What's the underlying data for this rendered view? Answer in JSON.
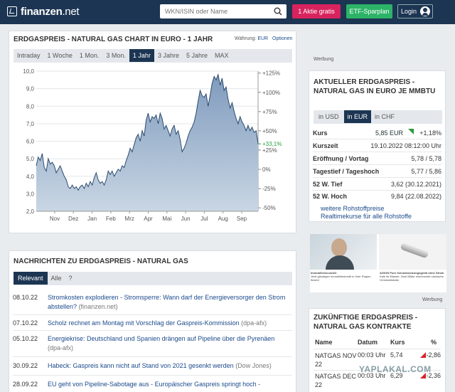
{
  "header": {
    "logo": "finanzen",
    "logo_suffix": ".net",
    "search_placeholder": "WKN/ISIN oder Name",
    "btn_aktie": "1 Aktie gratis",
    "btn_etf": "ETF-Sparplan",
    "btn_login": "Login"
  },
  "chart_panel": {
    "title": "ERDGASPREIS - NATURAL GAS CHART IN EURO - 1 JAHR",
    "waehrung_label": "Währung:",
    "waehrung_value": "EUR",
    "optionen": "Optionen",
    "tabs": [
      "Intraday",
      "1 Woche",
      "1 Mon.",
      "3 Mon.",
      "1 Jahr",
      "3 Jahre",
      "5 Jahre",
      "MAX"
    ],
    "active_tab": "1 Jahr"
  },
  "chart_data": {
    "type": "area",
    "x_ticks": [
      "Nov",
      "Dez",
      "Jan",
      "Feb",
      "Mrz",
      "Apr",
      "Mai",
      "Jun",
      "Jul",
      "Aug",
      "Sep"
    ],
    "y_ticks": [
      "2,0",
      "3,0",
      "4,0",
      "5,0",
      "6,0",
      "7,0",
      "8,0",
      "9,0",
      "10,0"
    ],
    "ylim": [
      2,
      10
    ],
    "y2_ticks": [
      "+125%",
      "+100%",
      "+75%",
      "+50%",
      "+25%",
      "0%",
      "-25%",
      "-50%"
    ],
    "y2_values": [
      125,
      100,
      75,
      50,
      25,
      0,
      -25,
      -50
    ],
    "current_label": "+33,1%",
    "current_value": 5.85,
    "series": [
      {
        "values": [
          4.6,
          5.1,
          4.9,
          5.3,
          4.5,
          4.3,
          5.0,
          4.7,
          4.8,
          4.6,
          4.2,
          4.4,
          4.6,
          4.3,
          4.0,
          3.8,
          3.4,
          3.3,
          3.5,
          3.3,
          3.4,
          3.2,
          3.4,
          3.5,
          3.3,
          3.6,
          3.4,
          3.7,
          3.5,
          3.9,
          4.2,
          3.8,
          3.6,
          3.7,
          3.5,
          3.8,
          4.3,
          4.1,
          4.3,
          4.0,
          4.2,
          4.4,
          4.3,
          4.6,
          4.5,
          4.9,
          5.2,
          5.6,
          5.4,
          5.8,
          6.2,
          6.4,
          6.0,
          6.6,
          6.3,
          7.2,
          7.6,
          7.1,
          7.4,
          7.3,
          7.5,
          7.0,
          7.6,
          7.3,
          6.7,
          6.9,
          6.6,
          6.3,
          6.7,
          6.9,
          6.4,
          6.6,
          6.1,
          5.4,
          5.6,
          5.9,
          6.3,
          6.6,
          6.8,
          7.1,
          7.6,
          8.3,
          8.9,
          8.6,
          8.5,
          8.7,
          8.0,
          8.6,
          9.3,
          9.7,
          9.5,
          9.8,
          9.2,
          9.6,
          8.9,
          9.1,
          8.4,
          7.9,
          8.2,
          7.7,
          7.3,
          7.0,
          7.4,
          7.1,
          6.9,
          6.6,
          6.9,
          6.6,
          6.8,
          6.5,
          6.6,
          5.85
        ]
      }
    ]
  },
  "news_panel": {
    "title": "NACHRICHTEN ZU ERDGASPREIS - NATURAL GAS",
    "tabs": [
      "Relevant",
      "Alle",
      "?"
    ],
    "items": [
      {
        "date": "08.10.22",
        "text": "Stromkosten explodieren - Stromsperre: Wann darf der Energieversorger den Strom abstellen?",
        "source": "(finanzen.net)"
      },
      {
        "date": "07.10.22",
        "text": "Scholz rechnet am Montag mit Vorschlag der Gaspreis-Kommission",
        "source": "(dpa-afx)"
      },
      {
        "date": "05.10.22",
        "text": "Energiekrise: Deutschland und Spanien drängen auf Pipeline über die Pyrenäen",
        "source": "(dpa-afx)"
      },
      {
        "date": "30.09.22",
        "text": "Habeck: Gaspreis kann nicht auf Stand von 2021 gesenkt werden",
        "source": "(Dow Jones)"
      },
      {
        "date": "28.09.22",
        "text": "EU geht von Pipeline-Sabotage aus - Europäischer Gaspreis springt hoch -",
        "source": ""
      }
    ]
  },
  "werbung_label": "Werbung",
  "current_panel": {
    "title": "AKTUELLER ERDGASPREIS - NATURAL GAS IN EURO JE MMBTU",
    "tabs": [
      "in USD",
      "in EUR",
      "in CHF"
    ],
    "active_tab": "in EUR",
    "rows": [
      {
        "key": "Kurs",
        "value": "5,85 EUR",
        "change": "+1,18%"
      },
      {
        "key": "Kurszeit",
        "value": "19.10.2022 08:12:00 Uhr"
      },
      {
        "key": "Eröffnung / Vortag",
        "value": "5,78 / 5,78"
      },
      {
        "key": "Tagestief / Tageshoch",
        "value": "5,77 / 5,86"
      },
      {
        "key": "52 W. Tief",
        "value": "3,62 (30.12.2021)"
      },
      {
        "key": "52 W. Hoch",
        "value": "9,84 (22.08.2022)"
      }
    ],
    "links": [
      "weitere Rohstoffpreise",
      "Realtimekurse für alle Rohstoffe"
    ]
  },
  "ads": [
    {
      "title": "Immobilienscout24",
      "text": "Jetzt günstigen Immobilienkredit in Ihrer Region finden!"
    },
    {
      "title": "AGION Pure Schutzbeutzungsgerät ohne Strom",
      "text": "Kalk im Wasser: Zwei Bilder erschrecken deutsche Grünkohlkäufer"
    }
  ],
  "future_panel": {
    "title": "ZUKÜNFTIGE ERDGASPREIS - NATURAL GAS KONTRAKTE",
    "headers": [
      "Name",
      "Datum",
      "Kurs",
      "%"
    ],
    "rows": [
      {
        "name": "NATGAS NOV 22",
        "date": "00:03 Uhr",
        "kurs": "5,74",
        "pct": "-2,86"
      },
      {
        "name": "NATGAS DEC 22",
        "date": "00:03 Uhr",
        "kurs": "6,29",
        "pct": "-2,36"
      }
    ]
  },
  "watermark": "YAPLAKAL.COM"
}
